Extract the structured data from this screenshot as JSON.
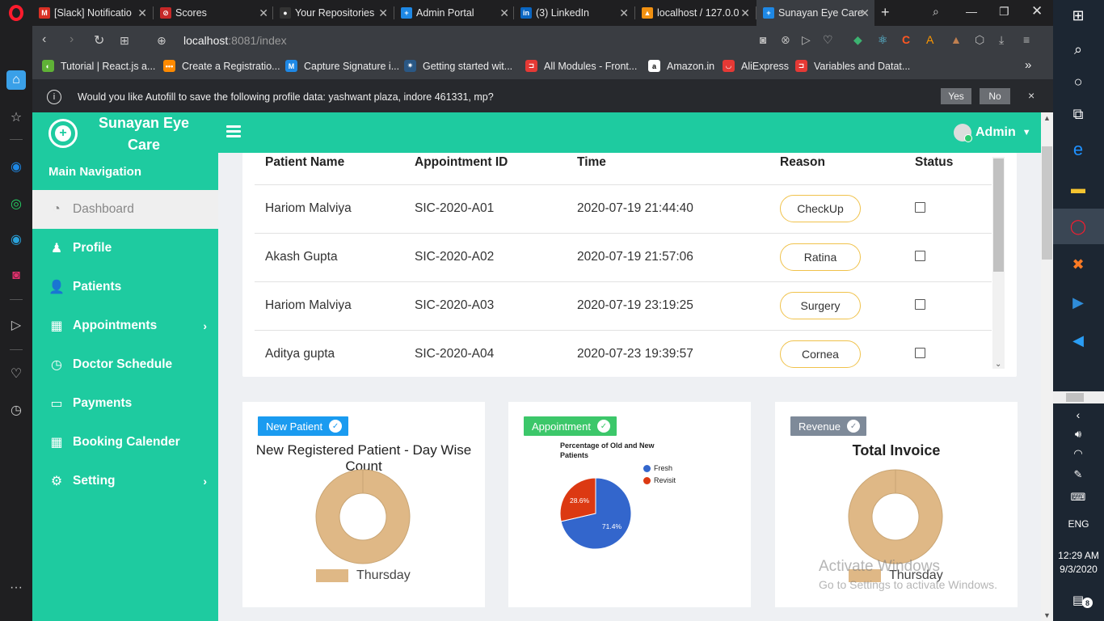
{
  "browser": {
    "tabs": [
      {
        "label": "[Slack] Notificatio",
        "icon": "gmail-icon",
        "color": "#d93025",
        "glyph": "M"
      },
      {
        "label": "Scores",
        "icon": "scores-icon",
        "color": "#c62828",
        "glyph": "⊘"
      },
      {
        "label": "Your Repositories",
        "icon": "github-icon",
        "color": "#333333",
        "glyph": "●"
      },
      {
        "label": "Admin Portal",
        "icon": "admin-portal-icon",
        "color": "#1e88e5",
        "glyph": "+"
      },
      {
        "label": "(3) LinkedIn",
        "icon": "linkedin-icon",
        "color": "#0a66c2",
        "glyph": "in"
      },
      {
        "label": "localhost / 127.0.0",
        "icon": "phpmyadmin-icon",
        "color": "#f29111",
        "glyph": "▲"
      },
      {
        "label": "Sunayan Eye Care",
        "icon": "sunayan-icon",
        "color": "#1e88e5",
        "glyph": "+"
      }
    ],
    "url_host": "localhost",
    "url_rest": ":8081/index",
    "bookmarks": [
      {
        "label": "Tutorial | React.js a...",
        "color": "#5fb236",
        "glyph": "◐"
      },
      {
        "label": "Create a Registratio...",
        "color": "#ff8a00",
        "glyph": "•••"
      },
      {
        "label": "Capture Signature i...",
        "color": "#1e88e5",
        "glyph": "M"
      },
      {
        "label": "Getting started wit...",
        "color": "#2a5885",
        "glyph": "✷"
      },
      {
        "label": "All Modules - Front...",
        "color": "#e53935",
        "glyph": "⊐"
      },
      {
        "label": "Amazon.in",
        "color": "#ffffff",
        "glyph": "a"
      },
      {
        "label": "AliExpress",
        "color": "#e53935",
        "glyph": "◡"
      },
      {
        "label": "Variables and Datat...",
        "color": "#e53935",
        "glyph": "⊐"
      }
    ],
    "autofill": {
      "message": "Would you like Autofill to save the following profile data: yashwant plaza, indore 461331, mp?",
      "yes": "Yes",
      "no": "No",
      "close": "×"
    }
  },
  "app": {
    "brand": "Sunayan Eye Care",
    "nav_heading": "Main Navigation",
    "menu": [
      {
        "label": "Dashboard",
        "icon": "dashboard-icon",
        "glyph": "◔",
        "active": true,
        "chevron": false
      },
      {
        "label": "Profile",
        "icon": "profile-icon",
        "glyph": "♟",
        "active": false,
        "chevron": false
      },
      {
        "label": "Patients",
        "icon": "patients-icon",
        "glyph": "👤",
        "active": false,
        "chevron": false
      },
      {
        "label": "Appointments",
        "icon": "calendar-check-icon",
        "glyph": "▦",
        "active": false,
        "chevron": true
      },
      {
        "label": "Doctor Schedule",
        "icon": "clock-icon",
        "glyph": "◷",
        "active": false,
        "chevron": false
      },
      {
        "label": "Payments",
        "icon": "money-icon",
        "glyph": "▭",
        "active": false,
        "chevron": false
      },
      {
        "label": "Booking Calender",
        "icon": "calendar-icon",
        "glyph": "▦",
        "active": false,
        "chevron": false
      },
      {
        "label": "Setting",
        "icon": "gear-icon",
        "glyph": "⚙",
        "active": false,
        "chevron": true
      }
    ],
    "user": "Admin"
  },
  "table": {
    "headers": [
      "Patient Name",
      "Appointment ID",
      "Time",
      "Reason",
      "Status"
    ],
    "rows": [
      {
        "name": "Hariom Malviya",
        "id": "SIC-2020-A01",
        "time": "2020-07-19 21:44:40",
        "reason": "CheckUp"
      },
      {
        "name": "Akash Gupta",
        "id": "SIC-2020-A02",
        "time": "2020-07-19 21:57:06",
        "reason": "Ratina"
      },
      {
        "name": "Hariom Malviya",
        "id": "SIC-2020-A03",
        "time": "2020-07-19 23:19:25",
        "reason": "Surgery"
      },
      {
        "name": "Aditya gupta",
        "id": "SIC-2020-A04",
        "time": "2020-07-23 19:39:57",
        "reason": "Cornea"
      }
    ]
  },
  "cards": {
    "new_patient": {
      "badge": "New Patient",
      "badge_color": "#1a9bf0",
      "title": "New Registered Patient -  Day Wise Count",
      "legend": "Thursday"
    },
    "appointment": {
      "badge": "Appointment",
      "badge_color": "#3cc76a",
      "title": "Percentage of Old and New Patients",
      "legend_fresh": "Fresh",
      "legend_revisit": "Revisit",
      "fresh_label": "71.4%",
      "revisit_label": "28.6%"
    },
    "revenue": {
      "badge": "Revenue",
      "badge_color": "#7e8a99",
      "title": "Total Invoice",
      "legend": "Thursday"
    }
  },
  "chart_data": [
    {
      "type": "pie",
      "title": "New Registered Patient -  Day Wise Count",
      "categories": [
        "Thursday"
      ],
      "values": [
        1
      ],
      "donut": true,
      "colors": [
        "#dfb886"
      ],
      "legend": "bottom"
    },
    {
      "type": "pie",
      "title": "Percentage of Old and New Patients",
      "categories": [
        "Fresh",
        "Revisit"
      ],
      "values": [
        71.4,
        28.6
      ],
      "colors": [
        "#3366cc",
        "#dc3912"
      ],
      "legend": "top-right"
    },
    {
      "type": "pie",
      "title": "Total Invoice",
      "categories": [
        "Thursday"
      ],
      "values": [
        1
      ],
      "donut": true,
      "colors": [
        "#dfb886"
      ],
      "legend": "bottom"
    }
  ],
  "watermark": {
    "line1": "Activate Windows",
    "line2": "Go to Settings to activate Windows."
  },
  "taskbar": {
    "lang": "ENG",
    "time": "12:29 AM",
    "date": "9/3/2020",
    "notifications": "8"
  }
}
